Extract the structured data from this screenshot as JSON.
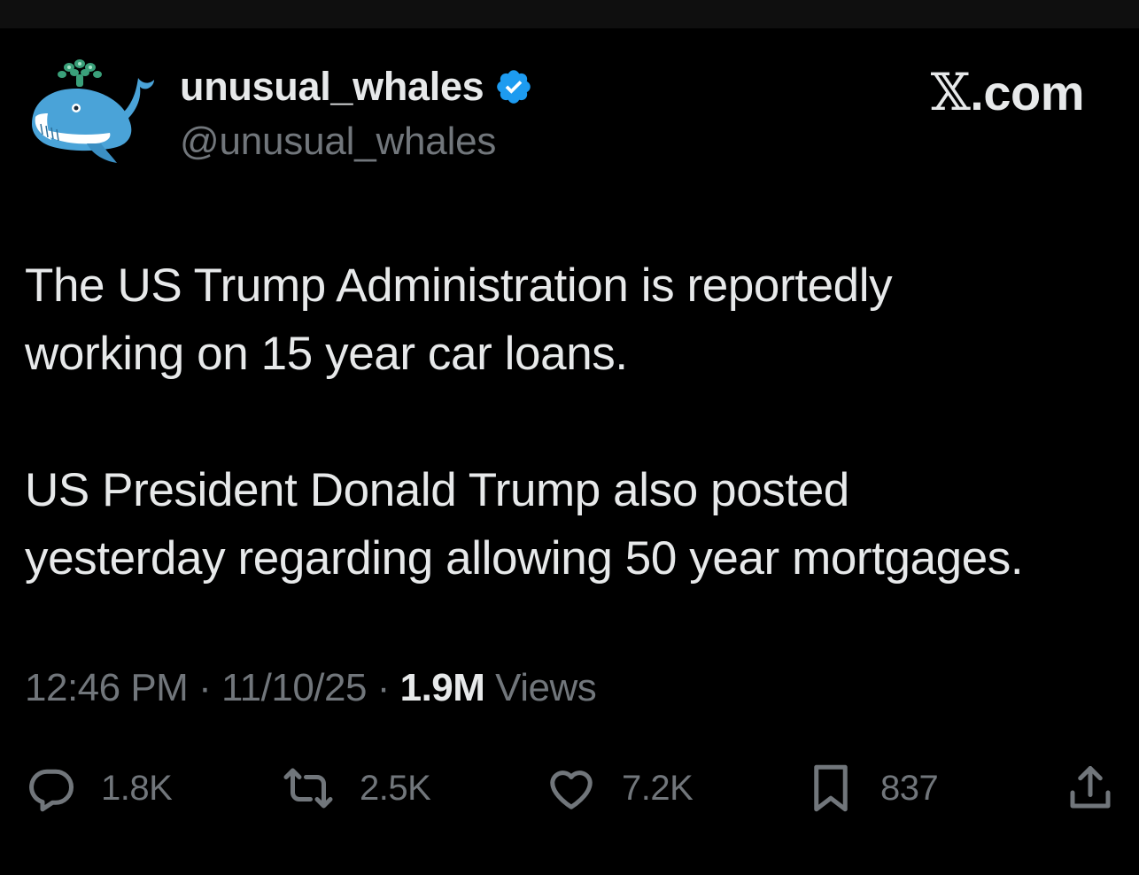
{
  "colors": {
    "background": "#000000",
    "text_primary": "#e7e9ea",
    "text_secondary": "#71767b",
    "verified": "#1d9bf0"
  },
  "author": {
    "display_name": "unusual_whales",
    "handle": "@unusual_whales",
    "avatar_icon": "whale-icon",
    "verified_icon": "verified-badge-icon"
  },
  "brand": {
    "x_mark": "𝕏",
    "suffix": ".com"
  },
  "tweet": {
    "paragraph_1": "The US Trump Administration is reportedly\nworking on 15 year car loans.",
    "paragraph_2": "US President Donald Trump also posted\nyesterday regarding allowing 50 year mortgages."
  },
  "meta": {
    "time": "12:46 PM",
    "separator": "·",
    "date": "11/10/25",
    "views_count": "1.9M",
    "views_label": "Views"
  },
  "actions": {
    "reply": {
      "icon": "reply-icon",
      "count": "1.8K"
    },
    "repost": {
      "icon": "repost-icon",
      "count": "2.5K"
    },
    "like": {
      "icon": "heart-icon",
      "count": "7.2K"
    },
    "bookmark": {
      "icon": "bookmark-icon",
      "count": "837"
    },
    "share": {
      "icon": "share-icon"
    }
  }
}
